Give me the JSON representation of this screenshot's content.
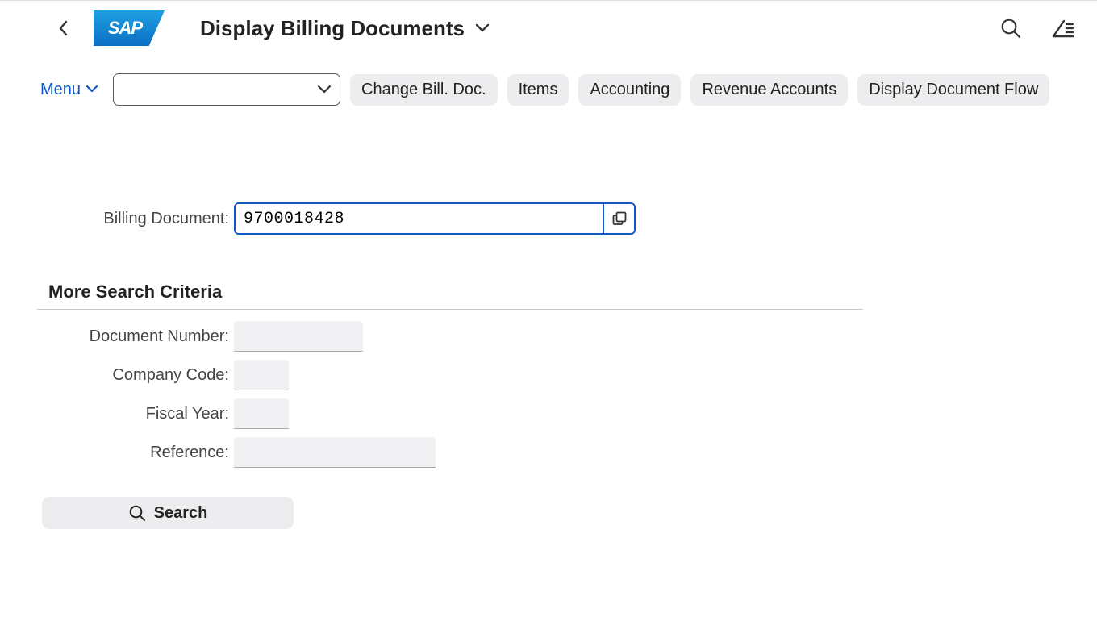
{
  "header": {
    "title": "Display Billing Documents"
  },
  "toolbar": {
    "menu_label": "Menu",
    "buttons": {
      "change_bill_doc": "Change Bill. Doc.",
      "items": "Items",
      "accounting": "Accounting",
      "revenue_accounts": "Revenue Accounts",
      "display_doc_flow": "Display Document Flow"
    }
  },
  "form": {
    "billing_document_label": "Billing Document:",
    "billing_document_value": "9700018428"
  },
  "criteria": {
    "section_title": "More Search Criteria",
    "document_number_label": "Document Number:",
    "document_number_value": "",
    "company_code_label": "Company Code:",
    "company_code_value": "",
    "fiscal_year_label": "Fiscal Year:",
    "fiscal_year_value": "",
    "reference_label": "Reference:",
    "reference_value": ""
  },
  "actions": {
    "search_label": "Search"
  }
}
